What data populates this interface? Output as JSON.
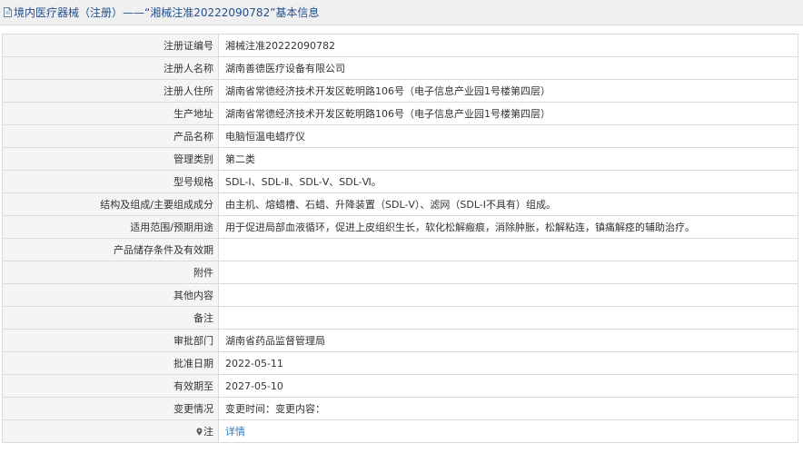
{
  "header": {
    "title": "境内医疗器械（注册）——“湘械注准20222090782”基本信息"
  },
  "rows": [
    {
      "label": "注册证编号",
      "value": "湘械注准20222090782"
    },
    {
      "label": "注册人名称",
      "value": "湖南善德医疗设备有限公司"
    },
    {
      "label": "注册人住所",
      "value": "湖南省常德经济技术开发区乾明路106号（电子信息产业园1号楼第四层）"
    },
    {
      "label": "生产地址",
      "value": "湖南省常德经济技术开发区乾明路106号（电子信息产业园1号楼第四层）"
    },
    {
      "label": "产品名称",
      "value": "电脑恒温电蜡疗仪"
    },
    {
      "label": "管理类别",
      "value": "第二类"
    },
    {
      "label": "型号规格",
      "value": "SDL-Ⅰ、SDL-Ⅱ、SDL-Ⅴ、SDL-Ⅵ。"
    },
    {
      "label": "结构及组成/主要组成成分",
      "value": "由主机、熔蜡槽、石蜡、升降装置（SDL-Ⅴ）、滤网（SDL-Ⅰ不具有）组成。"
    },
    {
      "label": "适用范围/预期用途",
      "value": "用于促进局部血液循环，促进上皮组织生长，软化松解瘢痕，消除肿胀，松解粘连，镇痛解痉的辅助治疗。"
    },
    {
      "label": "产品储存条件及有效期",
      "value": ""
    },
    {
      "label": "附件",
      "value": ""
    },
    {
      "label": "其他内容",
      "value": ""
    },
    {
      "label": "备注",
      "value": ""
    },
    {
      "label": "审批部门",
      "value": "湖南省药品监督管理局"
    },
    {
      "label": "批准日期",
      "value": "2022-05-11"
    },
    {
      "label": "有效期至",
      "value": "2027-05-10"
    },
    {
      "label": "变更情况",
      "value": "变更时间：变更内容："
    }
  ],
  "note": {
    "label": "注",
    "link_text": "详情",
    "icon": "map-pin-icon"
  },
  "colors": {
    "title_text": "#1f4f8f",
    "label_bg": "#f5f5f5",
    "border": "#dadada",
    "link": "#2e7bc4"
  }
}
